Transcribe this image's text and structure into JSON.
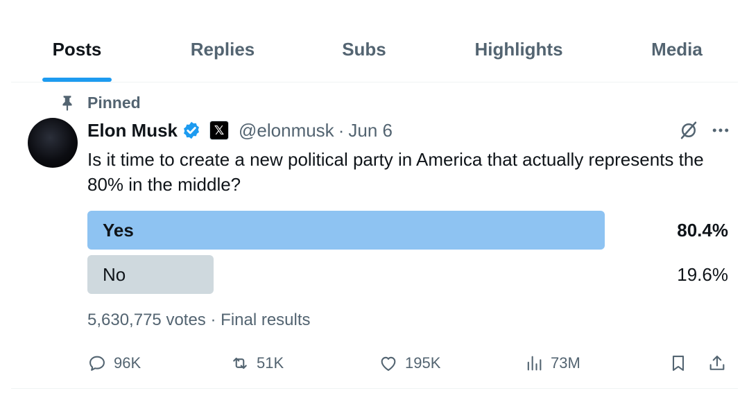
{
  "tabs": [
    {
      "label": "Posts",
      "active": true
    },
    {
      "label": "Replies",
      "active": false
    },
    {
      "label": "Subs",
      "active": false
    },
    {
      "label": "Highlights",
      "active": false
    },
    {
      "label": "Media",
      "active": false
    }
  ],
  "post": {
    "pinned_label": "Pinned",
    "author": {
      "name": "Elon Musk",
      "handle": "@elonmusk",
      "verified": true,
      "affiliate_badge": "𝕏"
    },
    "separator": "·",
    "date": "Jun 6",
    "text": "Is it time to create a new political party in America that actually represents the 80% in the middle?",
    "poll": {
      "options": [
        {
          "label": "Yes",
          "percent_text": "80.4%",
          "percent": 80.4,
          "winner": true
        },
        {
          "label": "No",
          "percent_text": "19.6%",
          "percent": 19.6,
          "winner": false
        }
      ],
      "votes": "5,630,775 votes",
      "status": "Final results"
    },
    "actions": {
      "replies": "96K",
      "reposts": "51K",
      "likes": "195K",
      "views": "73M"
    },
    "icons": {
      "pin": "pin-icon",
      "verified": "verified-icon",
      "grok": "grok-icon",
      "more": "more-icon",
      "reply": "reply-icon",
      "repost": "repost-icon",
      "like": "like-icon",
      "views": "views-icon",
      "bookmark": "bookmark-icon",
      "share": "share-icon"
    }
  },
  "colors": {
    "accent": "#1d9bf0",
    "winner_bar": "#8ec3f2",
    "loser_bar": "#cfd9de",
    "secondary_text": "#536471"
  }
}
